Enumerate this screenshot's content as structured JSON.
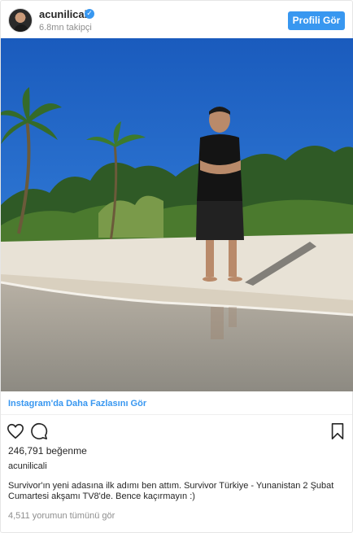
{
  "header": {
    "username": "acunilicali",
    "verified_icon": "verified-badge-icon",
    "followers": "6.8mn takipçi",
    "profile_button": "Profili Gör",
    "accent": "#3897f0"
  },
  "post": {
    "more_link": "Instagram'da Daha Fazlasını Gör",
    "icons": [
      "heart-icon",
      "comment-icon",
      "bookmark-icon"
    ],
    "likes": "246,791 beğenme",
    "owner": "acunilicali",
    "caption": "Survivor'ın yeni adasına ilk adımı ben attım. Survivor Türkiye - Yunanistan 2 Şubat Cumartesi akşamı TV8'de. Bence kaçırmayın :)",
    "comments_link": "4,511 yorumun tümünü gör"
  }
}
